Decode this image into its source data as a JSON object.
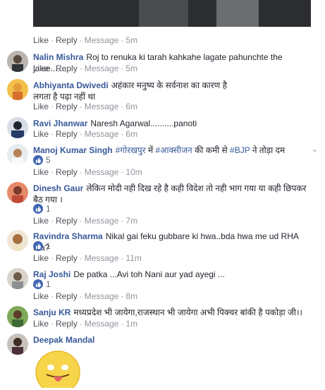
{
  "labels": {
    "like": "Like",
    "reply": "Reply",
    "message": "Message"
  },
  "top_actions": {
    "time": "5m"
  },
  "comments": [
    {
      "author": "Nalin Mishra",
      "text": "Roj to renuka ki tarah kahkahe lagate pahunchte the jaise.......",
      "time": "5m"
    },
    {
      "author": "Abhiyanta Dwivedi",
      "text": "अहंकार मनुष्य के सर्वनाश का कारण है",
      "text2": "लगता है पढ़ा नहीं था",
      "time": "6m"
    },
    {
      "author": "Ravi Jhanwar",
      "text": "Naresh Agarwal..........panoti",
      "time": "6m"
    },
    {
      "author": "Manoj Kumar Singh",
      "tag1": "#गोरखपुर",
      "text_mid": " में ",
      "tag2": "#आक्सीजन",
      "text_mid2": " की कमी से ",
      "tag3": "#BJP",
      "text_end": " ने तोड़ा दम",
      "likes": "5",
      "time": "10m"
    },
    {
      "author": "Dinesh Gaur",
      "text": "लेकिन मोदी नही दिख रहे है कही विदेश तो नही भाग गया या कही छिपकर",
      "text2": "बैठ गया ।",
      "likes": "1",
      "time": "7m"
    },
    {
      "author": "Ravindra Sharma",
      "text": "Nikal gai feku gubbare ki hwa..bda hwa me ud RHA tha?",
      "likes": "1",
      "time": "11m"
    },
    {
      "author": "Raj Joshi",
      "text": "De patka ...Avi toh Nani aur yad ayegi ...",
      "likes": "1",
      "time": "8m"
    },
    {
      "author": "Sanju KR",
      "text": "मध्यप्रदेश भी जायेगा,राजस्थान भी जायेगा अभी पिक्चर बांकी है पकोड़ा जी।।",
      "time": "1m"
    },
    {
      "author": "Deepak Mandal"
    }
  ],
  "menu_icon": "chevron-down-icon",
  "colors": {
    "author": "#365899",
    "meta": "#90949c",
    "like_badge": "#4267b2",
    "emoji": "#f7d54a"
  }
}
